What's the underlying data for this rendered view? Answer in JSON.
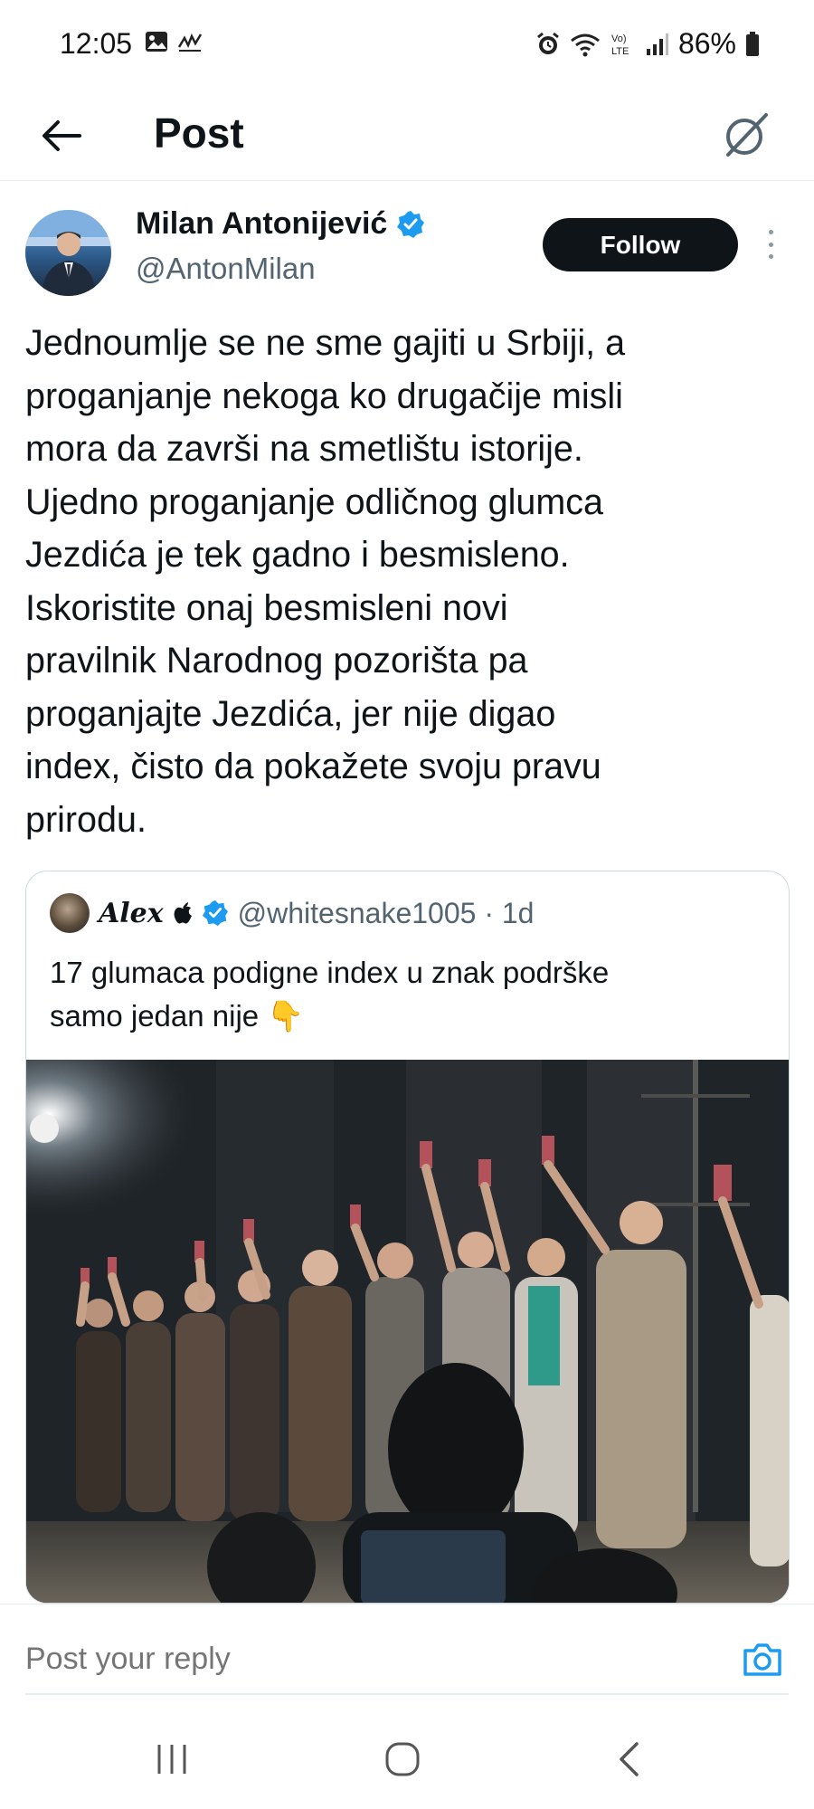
{
  "status_bar": {
    "time": "12:05",
    "battery": "86%",
    "icons": [
      "gallery-icon",
      "activity-icon",
      "alarm-icon",
      "wifi-icon",
      "volte-icon",
      "signal-icon",
      "battery-icon"
    ]
  },
  "header": {
    "title": "Post",
    "back_icon": "arrow-left-icon",
    "grok_icon": "grok-icon"
  },
  "tweet": {
    "author_name": "Milan Antonijević",
    "handle": "@AntonMilan",
    "verified": true,
    "follow_label": "Follow",
    "text": "Jednoumlje se ne sme gajiti u Srbiji, a\nproganjanje nekoga ko drugačije misli\nmora da završi na smetlištu istorije.\nUjedno proganjanje odličnog glumca\nJezdića je tek gadno i besmisleno.\nIskoristite onaj besmisleni novi\npravilnik Narodnog pozorišta pa\nproganjajte Jezdića, jer nije digao\nindex, čisto da pokažete svoju pravu\nprirodu."
  },
  "quote": {
    "author_name": "Alex",
    "name_suffix_icon": "apple-icon",
    "handle_meta": "@whitesnake1005 · 1d",
    "verified": true,
    "text": "17 glumaca podigne index u znak podrške\nsamo jedan nije 👇",
    "media": "video-thumbnail"
  },
  "reply": {
    "placeholder": "Post your reply",
    "camera_icon": "camera-icon"
  },
  "nav": {
    "icons": [
      "recent-apps-icon",
      "home-icon",
      "back-icon"
    ]
  },
  "colors": {
    "text": "#0f1419",
    "secondary": "#536471",
    "verified": "#1d9bf0",
    "follow_bg": "#0f1419"
  }
}
